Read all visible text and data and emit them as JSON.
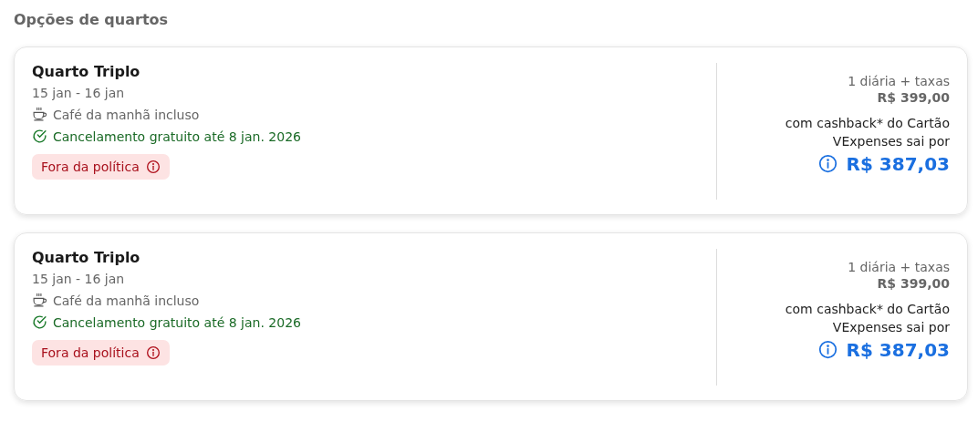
{
  "section_title": "Opções de quartos",
  "rooms": [
    {
      "name": "Quarto Triplo",
      "dates": "15 jan - 16 jan",
      "features": [
        {
          "kind": "breakfast",
          "text": "Café da manhã incluso"
        },
        {
          "kind": "cancellation",
          "text": "Cancelamento gratuito até 8 jan. 2026"
        }
      ],
      "policy_badge": "Fora da política",
      "price_label": "1 diária + taxas",
      "price": "R$ 399,00",
      "cashback_text": "com cashback* do Cartão VExpenses sai por",
      "final_price": "R$ 387,03"
    },
    {
      "name": "Quarto Triplo",
      "dates": "15 jan - 16 jan",
      "features": [
        {
          "kind": "breakfast",
          "text": "Café da manhã incluso"
        },
        {
          "kind": "cancellation",
          "text": "Cancelamento gratuito até 8 jan. 2026"
        }
      ],
      "policy_badge": "Fora da política",
      "price_label": "1 diária + taxas",
      "price": "R$ 399,00",
      "cashback_text": "com cashback* do Cartão VExpenses sai por",
      "final_price": "R$ 387,03"
    }
  ]
}
